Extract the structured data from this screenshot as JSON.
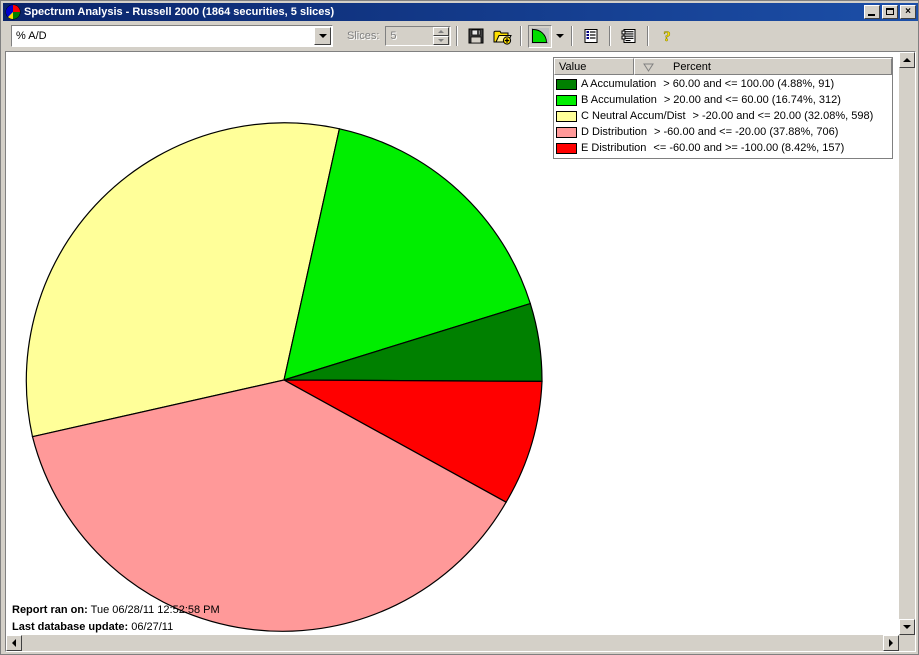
{
  "window": {
    "title": "Spectrum Analysis - Russell 2000 (1864 securities, 5 slices)",
    "app_icon": "pie-chart-icon",
    "minimize_label": "_",
    "maximize_label": "□",
    "close_label": "×"
  },
  "toolbar": {
    "indicator_combo": {
      "value": "% A/D",
      "placeholder": "% A/D"
    },
    "slices_label": "Slices:",
    "slices_value": "5",
    "buttons": [
      {
        "name": "save-button",
        "icon": "floppy-disk-icon",
        "tooltip": "Save"
      },
      {
        "name": "open-button",
        "icon": "open-folder-icon",
        "tooltip": "Open"
      },
      {
        "name": "chart-type-button",
        "icon": "pie-chart-icon",
        "tooltip": "Chart Type"
      },
      {
        "name": "chart-type-dropdown",
        "icon": "chevron-down-icon",
        "tooltip": "Chart Type Options"
      },
      {
        "name": "list-view-button",
        "icon": "list-view-icon",
        "tooltip": "List View"
      },
      {
        "name": "report-view-button",
        "icon": "report-view-icon",
        "tooltip": "Report View"
      },
      {
        "name": "help-button",
        "icon": "question-mark-icon",
        "tooltip": "Help"
      }
    ]
  },
  "legend": {
    "columns": [
      "Value",
      "Percent"
    ],
    "sort_indicator": "sort-ascending-icon",
    "rows": [
      {
        "color": "#008000",
        "label": "A Accumulation",
        "range": "> 60.00 and <= 100.00 (4.88%, 91)"
      },
      {
        "color": "#00ee00",
        "label": "B Accumulation",
        "range": "> 20.00 and <= 60.00 (16.74%, 312)"
      },
      {
        "color": "#ffff99",
        "label": "C Neutral Accum/Dist",
        "range": "> -20.00 and <= 20.00 (32.08%, 598)"
      },
      {
        "color": "#ff9999",
        "label": "D Distribution",
        "range": "> -60.00 and <= -20.00 (37.88%, 706)"
      },
      {
        "color": "#ff0000",
        "label": "E Distribution",
        "range": "<= -60.00 and >= -100.00 (8.42%, 157)"
      }
    ]
  },
  "footer": {
    "report_ran_label": "Report ran on:",
    "report_ran_value": "Tue 06/28/11 12:52:58 PM",
    "last_update_label": "Last database update:",
    "last_update_value": "06/27/11"
  },
  "chart_data": {
    "type": "pie",
    "title": "Spectrum Analysis - Russell 2000",
    "categories": [
      "A Accumulation",
      "B Accumulation",
      "C Neutral Accum/Dist",
      "D Distribution",
      "E Distribution"
    ],
    "values": [
      4.88,
      16.74,
      32.08,
      37.88,
      8.42
    ],
    "counts": [
      91,
      312,
      598,
      706,
      157
    ],
    "colors": [
      "#008000",
      "#00ee00",
      "#ffff99",
      "#ff9999",
      "#ff0000"
    ],
    "ranges": [
      "> 60.00 and <= 100.00",
      "> 20.00 and <= 60.00",
      "> -20.00 and <= 20.00",
      "> -60.00 and <= -20.00",
      "<= -60.00 and >= -100.00"
    ],
    "total_securities": 1864,
    "slice_count": 5,
    "start_angle_deg": 12.4,
    "draw_order": [
      "B Accumulation",
      "A Accumulation",
      "E Distribution",
      "D Distribution",
      "C Neutral Accum/Dist"
    ],
    "center": [
      278,
      328
    ],
    "radius": 258,
    "legend_position": "right",
    "unit": "percent"
  }
}
